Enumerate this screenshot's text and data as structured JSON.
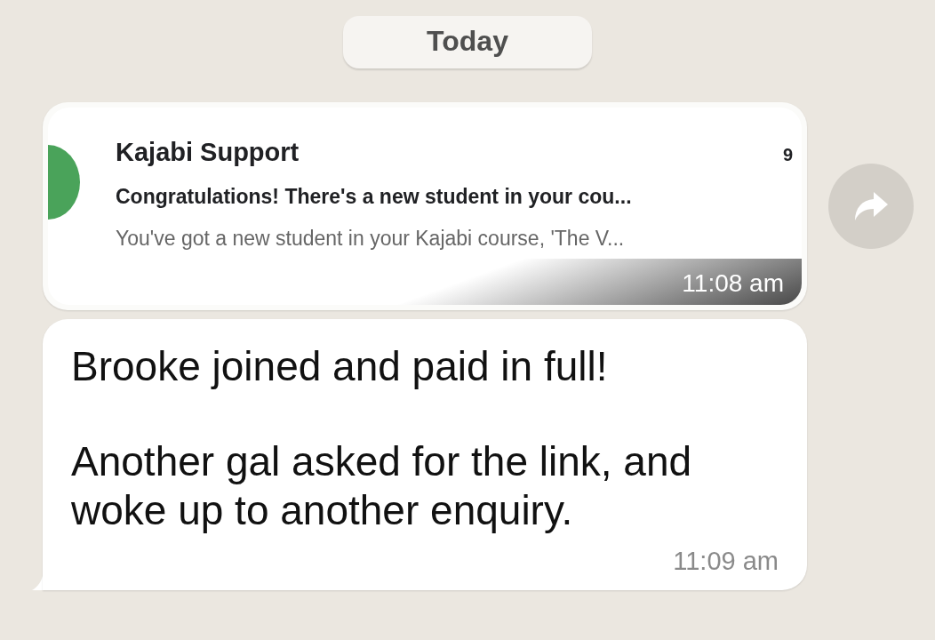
{
  "date_divider": "Today",
  "forwarded_card": {
    "sender": "Kajabi Support",
    "count": "9",
    "subject": "Congratulations! There's a new student in your cou...",
    "preview": "You've got a new student in your Kajabi course, 'The V...",
    "time": "11:08 am"
  },
  "message": {
    "paragraphs": [
      "Brooke joined and paid in full!",
      "Another gal asked for the link, and woke up to another enquiry."
    ],
    "time": "11:09 am"
  }
}
